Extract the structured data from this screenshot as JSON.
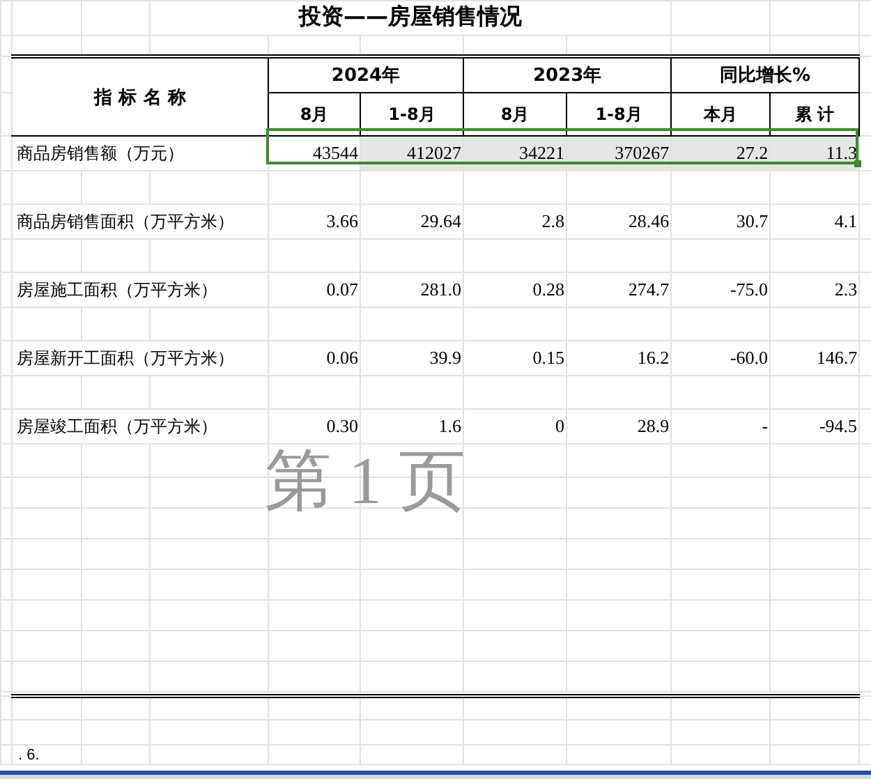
{
  "title": "投资——房屋销售情况",
  "header": {
    "label": "指 标 名 称",
    "groups": [
      {
        "label": "2024年",
        "columns": [
          "8月",
          "1-8月"
        ]
      },
      {
        "label": "2023年",
        "columns": [
          "8月",
          "1-8月"
        ]
      },
      {
        "label": "同比增长%",
        "columns": [
          "本月",
          "累 计"
        ]
      }
    ]
  },
  "rows": [
    {
      "name": "商品房销售额（万元）",
      "values": [
        "43544",
        "412027",
        "34221",
        "370267",
        "27.2",
        "11.3"
      ],
      "selected": true
    },
    {
      "name": "商品房销售面积（万平方米）",
      "values": [
        "3.66",
        "29.64",
        "2.8",
        "28.46",
        "30.7",
        "4.1"
      ],
      "selected": false
    },
    {
      "name": "房屋施工面积（万平方米）",
      "values": [
        "0.07",
        "281.0",
        "0.28",
        "274.7",
        "-75.0",
        "2.3"
      ],
      "selected": false
    },
    {
      "name": "房屋新开工面积（万平方米）",
      "values": [
        "0.06",
        "39.9",
        "0.15",
        "16.2",
        "-60.0",
        "146.7"
      ],
      "selected": false
    },
    {
      "name": "房屋竣工面积（万平方米）",
      "values": [
        "0.30",
        "1.6",
        "0",
        "28.9",
        "-",
        "-94.5"
      ],
      "selected": false
    }
  ],
  "page_label": "第 1 页",
  "footer_note": ". 6."
}
